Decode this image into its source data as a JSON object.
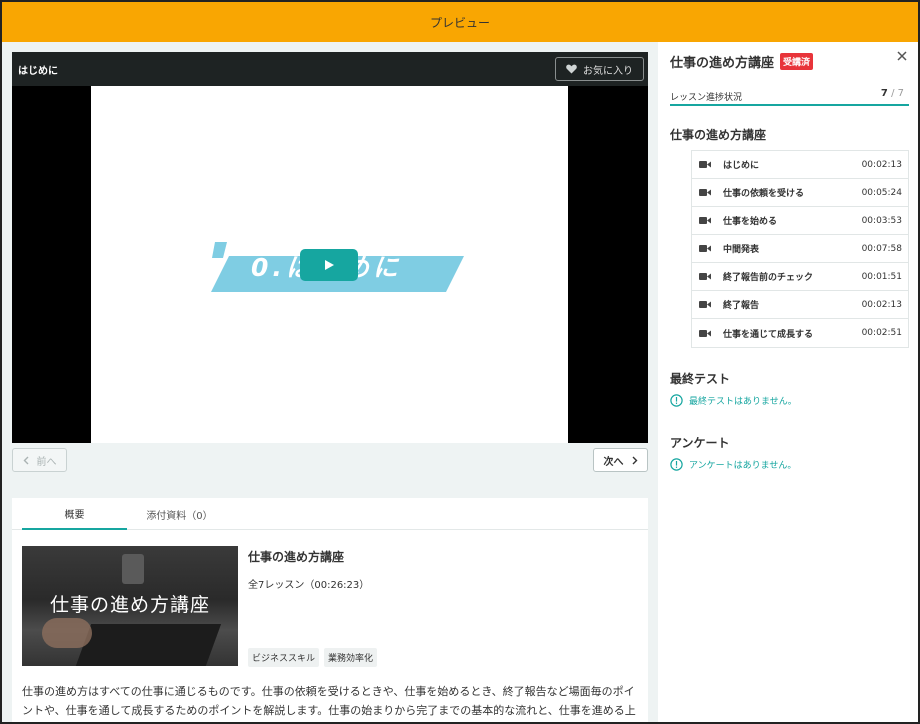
{
  "header": {
    "title": "プレビュー"
  },
  "video": {
    "title": "はじめに",
    "favorite_label": "お気に入り",
    "slide_text": "0.はじめに",
    "prev_label": "前へ",
    "next_label": "次へ"
  },
  "overview": {
    "tabs": [
      {
        "label": "概要"
      },
      {
        "label": "添付資料（0）"
      }
    ],
    "thumbnail_title": "仕事の進め方講座",
    "course_name": "仕事の進め方講座",
    "lesson_count": "全7レッスン（00:26:23）",
    "tags": [
      "ビジネススキル",
      "業務効率化"
    ],
    "description": "仕事の進め方はすべての仕事に通じるものです。仕事の依頼を受けるときや、仕事を始めるとき、終了報告など場面毎のポイントや、仕事を通して成長するためのポイントを解説します。仕事の始まりから完了までの基本的な流れと、仕事を進める上で覚えてお"
  },
  "sidebar": {
    "course_title": "仕事の進め方講座",
    "badge": "受講済",
    "progress_label": "レッスン進捗状況",
    "progress_done": "7",
    "progress_total": "/ 7",
    "progress_fraction": 1.0,
    "section_title": "仕事の進め方講座",
    "lessons": [
      {
        "name": "はじめに",
        "duration": "00:02:13"
      },
      {
        "name": "仕事の依頼を受ける",
        "duration": "00:05:24"
      },
      {
        "name": "仕事を始める",
        "duration": "00:03:53"
      },
      {
        "name": "中間発表",
        "duration": "00:07:58"
      },
      {
        "name": "終了報告前のチェック",
        "duration": "00:01:51"
      },
      {
        "name": "終了報告",
        "duration": "00:02:13"
      },
      {
        "name": "仕事を通じて成長する",
        "duration": "00:02:51"
      }
    ],
    "final_test": {
      "title": "最終テスト",
      "notice": "最終テストはありません。"
    },
    "survey": {
      "title": "アンケート",
      "notice": "アンケートはありません。"
    }
  },
  "colors": {
    "accent": "#16a6a0",
    "header": "#f9a602",
    "badge": "#e8343a",
    "banner": "#7fcde3"
  },
  "icons": [
    "heart-icon",
    "play-icon",
    "chevron-left-icon",
    "chevron-right-icon",
    "close-icon",
    "video-camera-icon",
    "info-circle-icon"
  ]
}
